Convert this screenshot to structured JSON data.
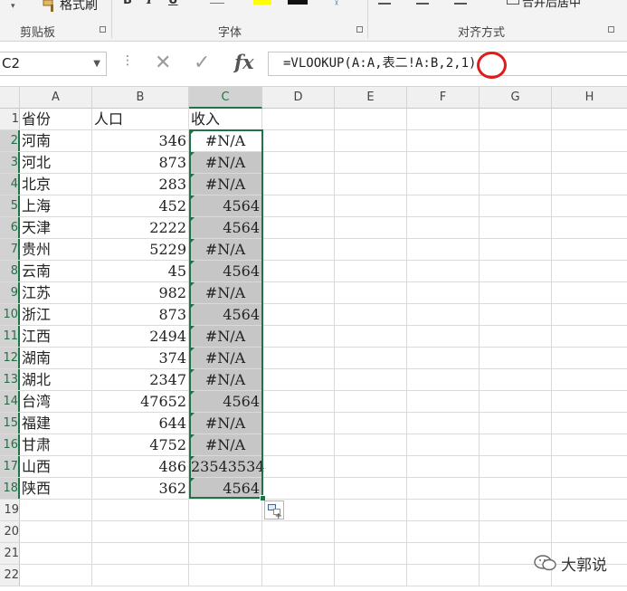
{
  "ribbon": {
    "format_painter_label": "格式刷",
    "group_clipboard": "剪贴板",
    "group_font": "字体",
    "group_alignment": "对齐方式",
    "merge_label": "合并后居中",
    "bold": "B",
    "italic": "I",
    "underline": "U",
    "highlight_color": "#ffff00",
    "font_color": "#111111",
    "accent_color": "#217346"
  },
  "formula_bar": {
    "name_box": "C2",
    "fx_label": "fx",
    "formula": "=VLOOKUP(A:A,表二!A:B,2,1)",
    "highlight_color": "#e01b1b"
  },
  "columns": [
    "A",
    "B",
    "C",
    "D",
    "E",
    "F",
    "G",
    "H"
  ],
  "header_row": {
    "row": "1",
    "a": "省份",
    "b": "人口",
    "c": "收入"
  },
  "rows": [
    {
      "row": "2",
      "a": "河南",
      "b": "346",
      "c": "#N/A"
    },
    {
      "row": "3",
      "a": "河北",
      "b": "873",
      "c": "#N/A"
    },
    {
      "row": "4",
      "a": "北京",
      "b": "283",
      "c": "#N/A"
    },
    {
      "row": "5",
      "a": "上海",
      "b": "452",
      "c": "4564"
    },
    {
      "row": "6",
      "a": "天津",
      "b": "2222",
      "c": "4564"
    },
    {
      "row": "7",
      "a": "贵州",
      "b": "5229",
      "c": "#N/A"
    },
    {
      "row": "8",
      "a": "云南",
      "b": "45",
      "c": "4564"
    },
    {
      "row": "9",
      "a": "江苏",
      "b": "982",
      "c": "#N/A"
    },
    {
      "row": "10",
      "a": "浙江",
      "b": "873",
      "c": "4564"
    },
    {
      "row": "11",
      "a": "江西",
      "b": "2494",
      "c": "#N/A"
    },
    {
      "row": "12",
      "a": "湖南",
      "b": "374",
      "c": "#N/A"
    },
    {
      "row": "13",
      "a": "湖北",
      "b": "2347",
      "c": "#N/A"
    },
    {
      "row": "14",
      "a": "台湾",
      "b": "47652",
      "c": "4564"
    },
    {
      "row": "15",
      "a": "福建",
      "b": "644",
      "c": "#N/A"
    },
    {
      "row": "16",
      "a": "甘肃",
      "b": "4752",
      "c": "#N/A"
    },
    {
      "row": "17",
      "a": "山西",
      "b": "486",
      "c": "23543534"
    },
    {
      "row": "18",
      "a": "陕西",
      "b": "362",
      "c": "4564"
    }
  ],
  "empty_rows": [
    "19",
    "20",
    "21",
    "22"
  ],
  "watermark": {
    "text": "大郭说",
    "icon": "wechat-icon"
  }
}
